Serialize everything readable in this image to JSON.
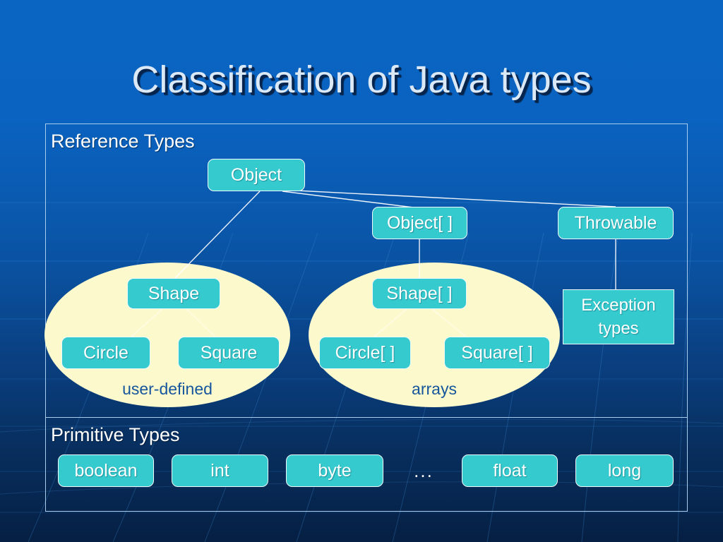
{
  "slide": {
    "title": "Classification of Java types",
    "sections": {
      "reference_label": "Reference Types",
      "primitive_label": "Primitive Types"
    },
    "groups": {
      "user_defined_label": "user-defined",
      "arrays_label": "arrays"
    },
    "nodes": {
      "object": "Object",
      "object_array": "Object[ ]",
      "throwable": "Throwable",
      "exception_types": "Exception types",
      "shape": "Shape",
      "circle": "Circle",
      "square": "Square",
      "shape_array": "Shape[ ]",
      "circle_array": "Circle[ ]",
      "square_array": "Square[ ]"
    },
    "primitives": {
      "boolean": "boolean",
      "int": "int",
      "byte": "byte",
      "ellipsis": "...",
      "float": "float",
      "long": "long"
    },
    "colors": {
      "background_top": "#0a64c2",
      "background_bottom": "#061f43",
      "node_fill": "#35cace",
      "node_border": "#eef9fb",
      "ellipse_fill": "#fcfacd",
      "ellipse_label_text": "#17559c",
      "frame_border": "#a9cdec",
      "title_text": "#dbe9f7",
      "body_text": "#ffffff"
    }
  }
}
